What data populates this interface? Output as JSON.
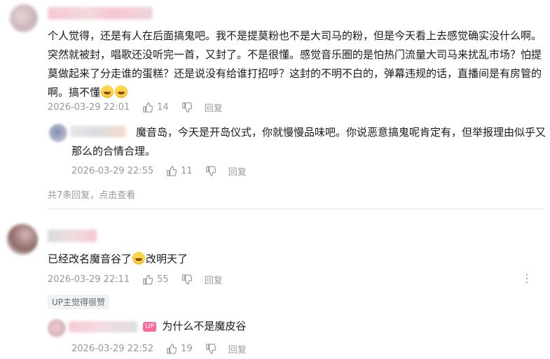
{
  "comments": [
    {
      "text": "个人觉得，还是有人在后面搞鬼吧。我不是提莫粉也不是大司马的粉，但是今天看上去感觉确实没什么啊。突然就被封，唱歌还没听完一首，又封了。不是很懂。感觉音乐圈的是怕热门流量大司马来扰乱市场？怕提莫做起来了分走谁的蛋糕？还是说没有给谁打招呼？这封的不明不白的，弹幕违规的话，直播间是有房管的啊。搞不懂",
      "lines": [
        "个人觉得，还是有人在后面搞鬼吧。我不是提莫粉也不是大司马的粉，但是今天看上去感觉确实没什么啊。",
        "突然就被封，唱歌还没听完一首，又封了。不是很懂。感觉音乐圈的是怕热门流量大司马来扰乱市场？怕提",
        "莫做起来了分走谁的蛋糕？还是说没有给谁打招呼？这封的不明不白的，弹幕违规的话，直播间是有房管的",
        "啊。搞不懂"
      ],
      "time": "2026-03-29 22:01",
      "likes": "14",
      "reply_label": "回复",
      "sub_reply": {
        "author": "魔音岛",
        "text": "，今天是开岛仪式，你就慢慢品味吧。你说恶意搞鬼呢肯定有，但举报理由似乎又",
        "text2": "那么的合情合理。",
        "time": "2026-03-29 22:55",
        "likes": "11",
        "reply_label": "回复"
      },
      "more_replies": "共7条回复，点击查看"
    },
    {
      "text": "已经改名魔音谷了",
      "text_after": "改明天了",
      "time": "2026-03-29 22:11",
      "likes": "55",
      "reply_label": "回复",
      "badge": "UP主觉得很赞",
      "sub_reply": {
        "up_tag": "UP",
        "text": "为什么不是魔皮谷",
        "time": "2026-03-29 22:52",
        "likes": "19",
        "reply_label": "回复"
      }
    }
  ],
  "icons": {
    "like": "thumbs-up-icon",
    "dislike": "thumbs-down-icon",
    "more": "more-vertical-icon",
    "emoji": "laughing-face-emoji"
  },
  "colors": {
    "meta": "#9499a0",
    "up_tag": "#ff6699",
    "divider": "#e3e5e7"
  }
}
